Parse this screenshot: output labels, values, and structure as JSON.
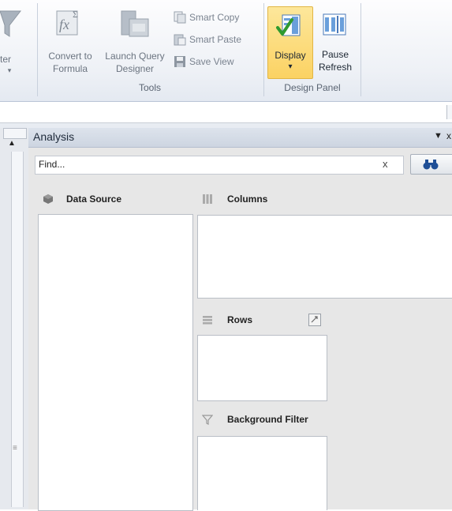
{
  "ribbon": {
    "filter_partial": "ter",
    "convert": {
      "line1": "Convert to",
      "line2": "Formula"
    },
    "launch_query": {
      "line1": "Launch Query",
      "line2": "Designer"
    },
    "smart_copy": "Smart Copy",
    "smart_paste": "Smart Paste",
    "save_view": "Save View",
    "tools_group": "Tools",
    "display": {
      "label": "Display",
      "dropdown": "▾"
    },
    "pause": {
      "line1": "Pause",
      "line2": "Refresh"
    },
    "design_panel_group": "Design Panel"
  },
  "panel": {
    "title": "Analysis",
    "search_placeholder": "Find...",
    "search_clear": "x",
    "data_source": "Data Source",
    "columns": "Columns",
    "rows": "Rows",
    "background_filter": "Background Filter"
  },
  "colors": {
    "display_button_bg": "#fbd769",
    "panel_bg": "#e7e7e7",
    "header_bg": "#d3dae6"
  }
}
